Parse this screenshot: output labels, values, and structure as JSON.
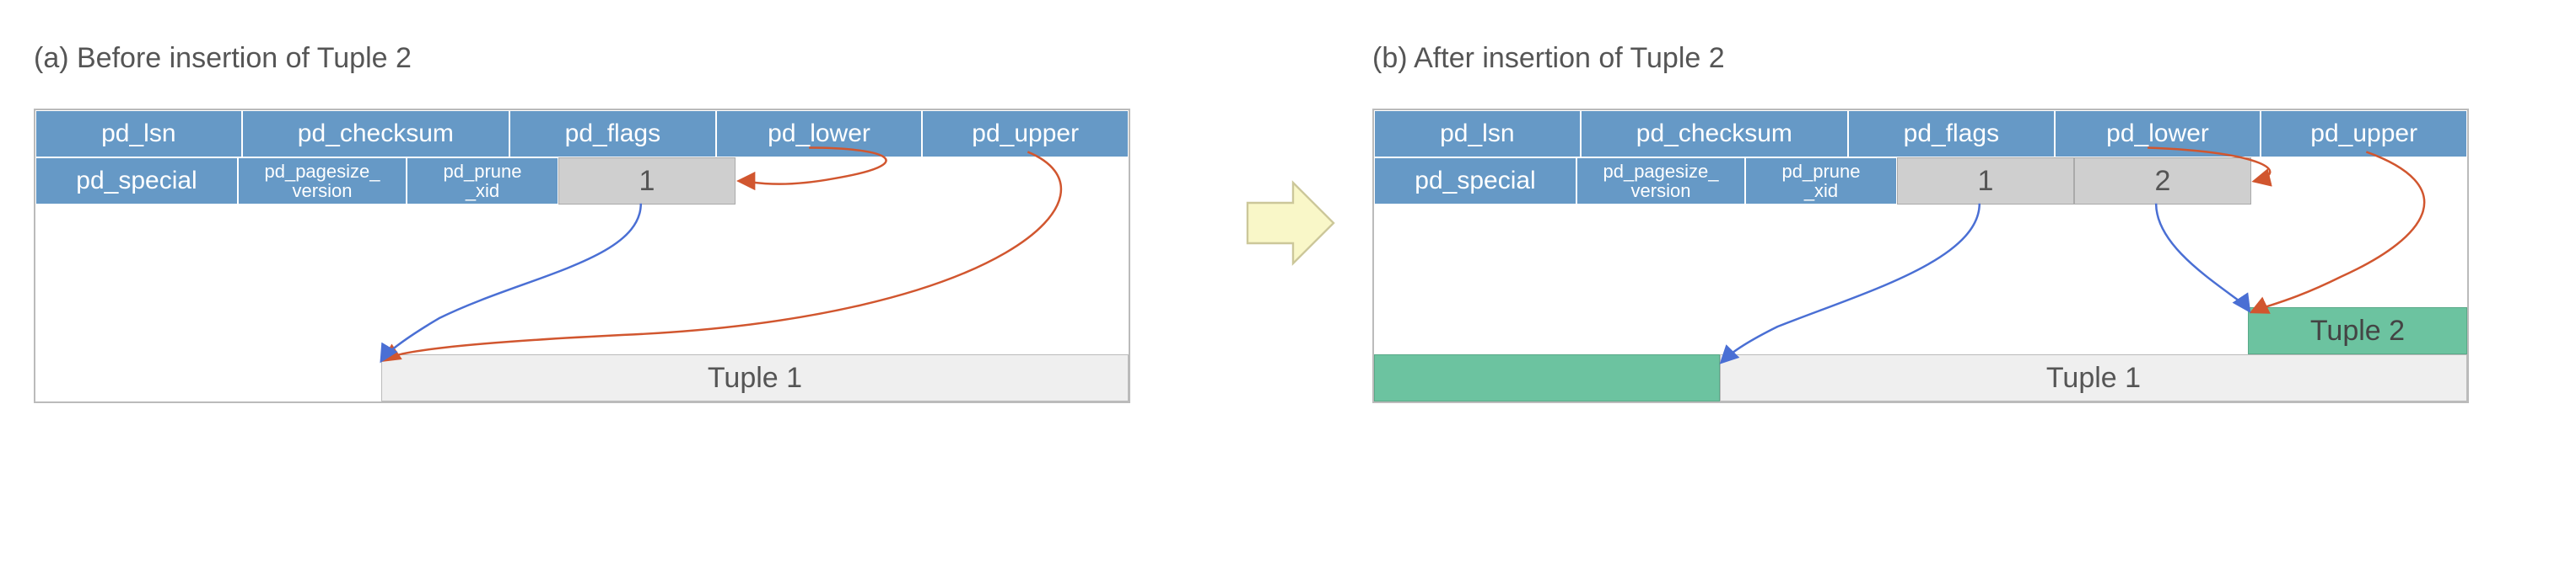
{
  "panelA": {
    "title": "(a) Before insertion of Tuple 2",
    "header_row1": [
      "pd_lsn",
      "pd_checksum",
      "pd_flags",
      "pd_lower",
      "pd_upper"
    ],
    "header_row2": [
      "pd_special",
      "pd_pagesize_\nversion",
      "pd_prune\n_xid"
    ],
    "line_pointers": [
      "1"
    ],
    "tuples": [
      "Tuple 1"
    ]
  },
  "panelB": {
    "title": "(b) After insertion of Tuple 2",
    "header_row1": [
      "pd_lsn",
      "pd_checksum",
      "pd_flags",
      "pd_lower",
      "pd_upper"
    ],
    "header_row2": [
      "pd_special",
      "pd_pagesize_\nversion",
      "pd_prune\n_xid"
    ],
    "line_pointers": [
      "1",
      "2"
    ],
    "tuples": [
      "Tuple 1",
      "Tuple 2"
    ]
  },
  "colors": {
    "header_bg": "#6699c6",
    "line_pointer_bg": "#cfcfcf",
    "tuple1_bg": "#efefef",
    "tuple2_bg": "#6cc3a0",
    "arrow_blue": "#4a6fd4",
    "arrow_red": "#d1562f",
    "big_arrow_fill": "#f9f7c8",
    "big_arrow_stroke": "#ccc79a"
  }
}
